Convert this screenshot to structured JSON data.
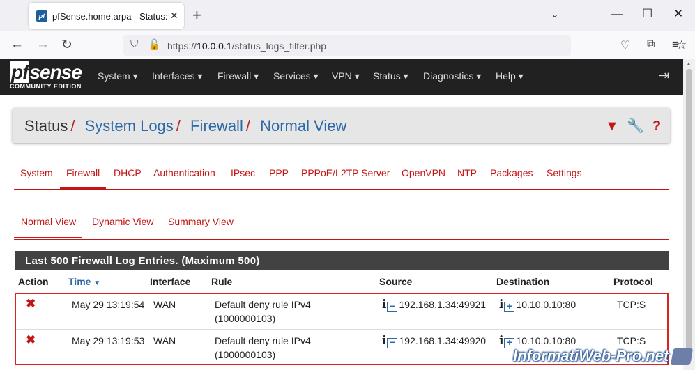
{
  "browser": {
    "tab_title": "pfSense.home.arpa - Status: System Logs",
    "url_prefix": "https://",
    "url_host": "10.0.0.1",
    "url_path": "/status_logs_filter.php"
  },
  "menu": [
    "System",
    "Interfaces",
    "Firewall",
    "Services",
    "VPN",
    "Status",
    "Diagnostics",
    "Help"
  ],
  "logo": {
    "main": "sense",
    "prefix": "pf",
    "sub": "COMMUNITY EDITION"
  },
  "breadcrumb": [
    "Status",
    "System Logs",
    "Firewall",
    "Normal View"
  ],
  "log_tabs": [
    "System",
    "Firewall",
    "DHCP",
    "Authentication",
    "IPsec",
    "PPP",
    "PPPoE/L2TP Server",
    "OpenVPN",
    "NTP",
    "Packages",
    "Settings"
  ],
  "log_tabs_active": "Firewall",
  "view_tabs": [
    "Normal View",
    "Dynamic View",
    "Summary View"
  ],
  "view_tabs_active": "Normal View",
  "panel_title": "Last 500 Firewall Log Entries. (Maximum 500)",
  "columns": [
    "Action",
    "Time",
    "Interface",
    "Rule",
    "Source",
    "Destination",
    "Protocol"
  ],
  "rows": [
    {
      "time": "May 29 13:19:54",
      "interface": "WAN",
      "rule_line1": "Default deny rule IPv4",
      "rule_line2": "(1000000103)",
      "source": "192.168.1.34:49921",
      "destination": "10.10.0.10:80",
      "protocol": "TCP:S"
    },
    {
      "time": "May 29 13:19:53",
      "interface": "WAN",
      "rule_line1": "Default deny rule IPv4",
      "rule_line2": "(1000000103)",
      "source": "192.168.1.34:49920",
      "destination": "10.10.0.10:80",
      "protocol": "TCP:S"
    }
  ],
  "watermark": "InformatiWeb-Pro.net",
  "colors": {
    "accent": "#c41515",
    "link": "#2b6aa6",
    "header": "#212121",
    "panel_head": "#424242"
  }
}
